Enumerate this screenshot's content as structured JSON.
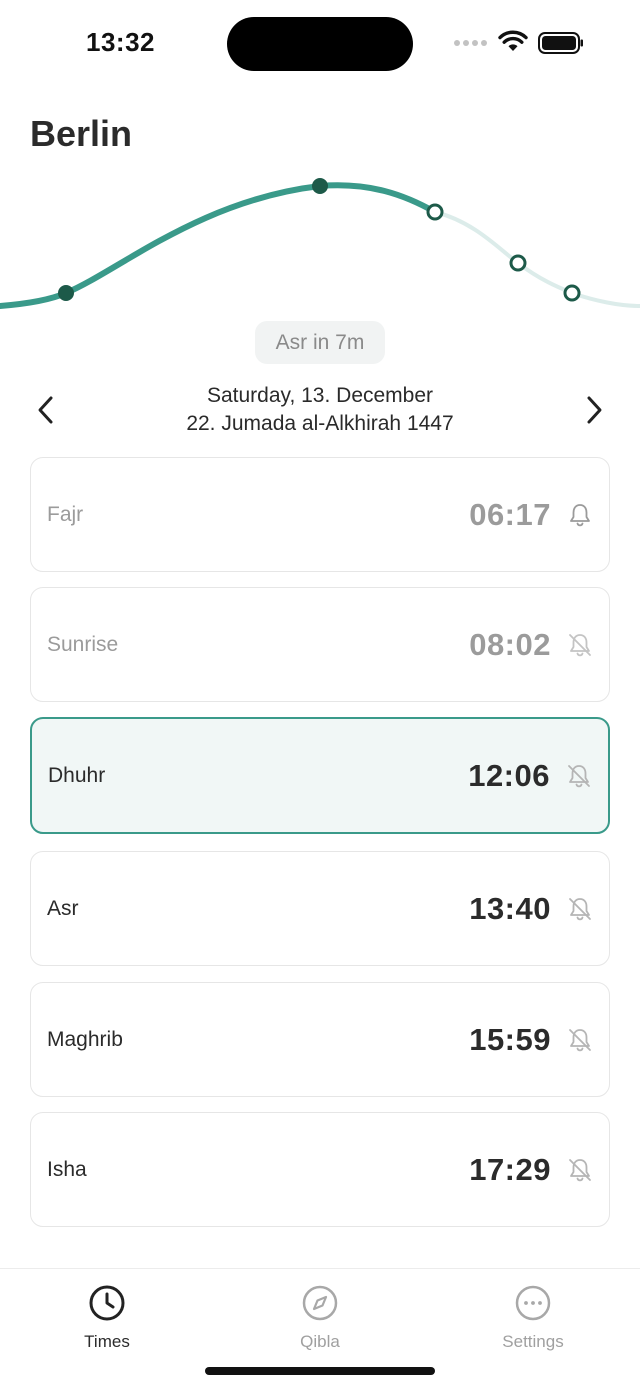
{
  "status": {
    "time": "13:32"
  },
  "city": "Berlin",
  "next_prayer_pill": "Asr in 7m",
  "date": {
    "gregorian": "Saturday, 13. December",
    "hijri": "22. Jumada al-Alkhirah 1447"
  },
  "prayers": [
    {
      "name": "Fajr",
      "time": "06:17",
      "state": "past",
      "notification": "on"
    },
    {
      "name": "Sunrise",
      "time": "08:02",
      "state": "past",
      "notification": "off"
    },
    {
      "name": "Dhuhr",
      "time": "12:06",
      "state": "current",
      "notification": "off"
    },
    {
      "name": "Asr",
      "time": "13:40",
      "state": "upcoming",
      "notification": "off"
    },
    {
      "name": "Maghrib",
      "time": "15:59",
      "state": "upcoming",
      "notification": "off"
    },
    {
      "name": "Isha",
      "time": "17:29",
      "state": "upcoming",
      "notification": "off"
    }
  ],
  "tabs": [
    {
      "label": "Times",
      "icon": "clock-icon",
      "active": true
    },
    {
      "label": "Qibla",
      "icon": "compass-icon",
      "active": false
    },
    {
      "label": "Settings",
      "icon": "ellipsis-circle-icon",
      "active": false
    }
  ],
  "colors": {
    "accent": "#3a9a8a",
    "dark_dot": "#1d5a49",
    "faded_curve": "#dcecea",
    "active_card_bg": "#f1f7f6"
  }
}
